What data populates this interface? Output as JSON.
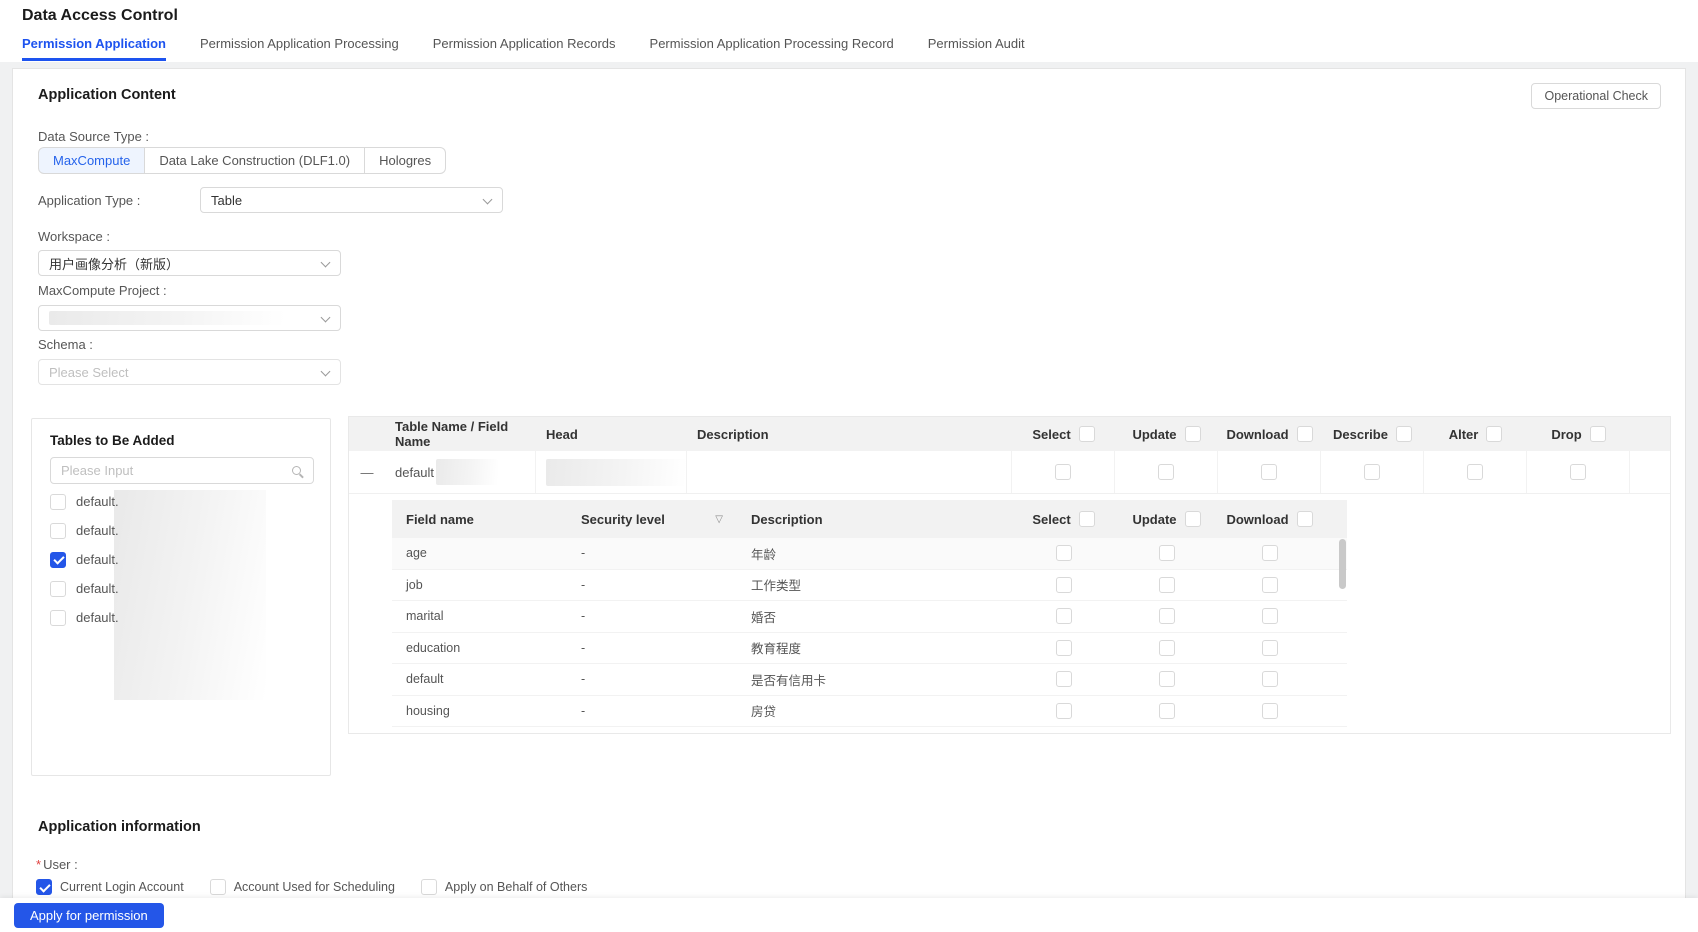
{
  "page_title": "Data Access Control",
  "tabs": [
    {
      "label": "Permission Application",
      "active": true
    },
    {
      "label": "Permission Application Processing",
      "active": false
    },
    {
      "label": "Permission Application Records",
      "active": false
    },
    {
      "label": "Permission Application Processing Record",
      "active": false
    },
    {
      "label": "Permission Audit",
      "active": false
    }
  ],
  "application_content": {
    "title": "Application Content",
    "operational_check_label": "Operational Check",
    "data_source_type": {
      "label": "Data Source Type :",
      "options": [
        "MaxCompute",
        "Data Lake Construction (DLF1.0)",
        "Hologres"
      ],
      "selected": "MaxCompute"
    },
    "application_type": {
      "label": "Application Type :",
      "value": "Table"
    },
    "workspace": {
      "label": "Workspace :",
      "value": "用户画像分析（新版）"
    },
    "maxcompute_project": {
      "label": "MaxCompute Project :",
      "value": ""
    },
    "schema": {
      "label": "Schema :",
      "placeholder": "Please Select"
    }
  },
  "tables_to_add": {
    "title": "Tables to Be Added",
    "search_placeholder": "Please Input",
    "items": [
      {
        "label": "default.",
        "checked": false
      },
      {
        "label": "default.",
        "checked": false
      },
      {
        "label": "default.",
        "checked": true
      },
      {
        "label": "default.",
        "checked": false
      },
      {
        "label": "default.",
        "checked": false
      }
    ]
  },
  "permission_table": {
    "columns": {
      "name": "Table Name / Field Name",
      "head": "Head",
      "description": "Description",
      "select": "Select",
      "update": "Update",
      "download": "Download",
      "describe": "Describe",
      "alter": "Alter",
      "drop": "Drop"
    },
    "row": {
      "collapse_glyph": "—",
      "table_name": "default"
    },
    "field_table": {
      "columns": {
        "field": "Field name",
        "security": "Security level",
        "description": "Description",
        "select": "Select",
        "update": "Update",
        "download": "Download"
      },
      "filter_icon_glyph": "▽",
      "rows": [
        {
          "field": "age",
          "security": "-",
          "description": "年龄"
        },
        {
          "field": "job",
          "security": "-",
          "description": "工作类型"
        },
        {
          "field": "marital",
          "security": "-",
          "description": "婚否"
        },
        {
          "field": "education",
          "security": "-",
          "description": "教育程度"
        },
        {
          "field": "default",
          "security": "-",
          "description": "是否有信用卡"
        },
        {
          "field": "housing",
          "security": "-",
          "description": "房贷"
        }
      ]
    }
  },
  "application_information": {
    "title": "Application information",
    "required_mark": "*",
    "user_label": "User :",
    "options": [
      {
        "label": "Current Login Account",
        "checked": true
      },
      {
        "label": "Account Used for Scheduling",
        "checked": false
      },
      {
        "label": "Apply on Behalf of Others",
        "checked": false
      }
    ]
  },
  "footer": {
    "apply_label": "Apply for permission"
  },
  "colors": {
    "accent": "#2456e8",
    "active_tab": "#1d53ef",
    "accent_light_bg": "#eef4fe",
    "table_header_bg": "#f2f2f2",
    "border": "#e4e4e4",
    "text_primary": "#1b1b1b",
    "text_secondary": "#555555"
  }
}
